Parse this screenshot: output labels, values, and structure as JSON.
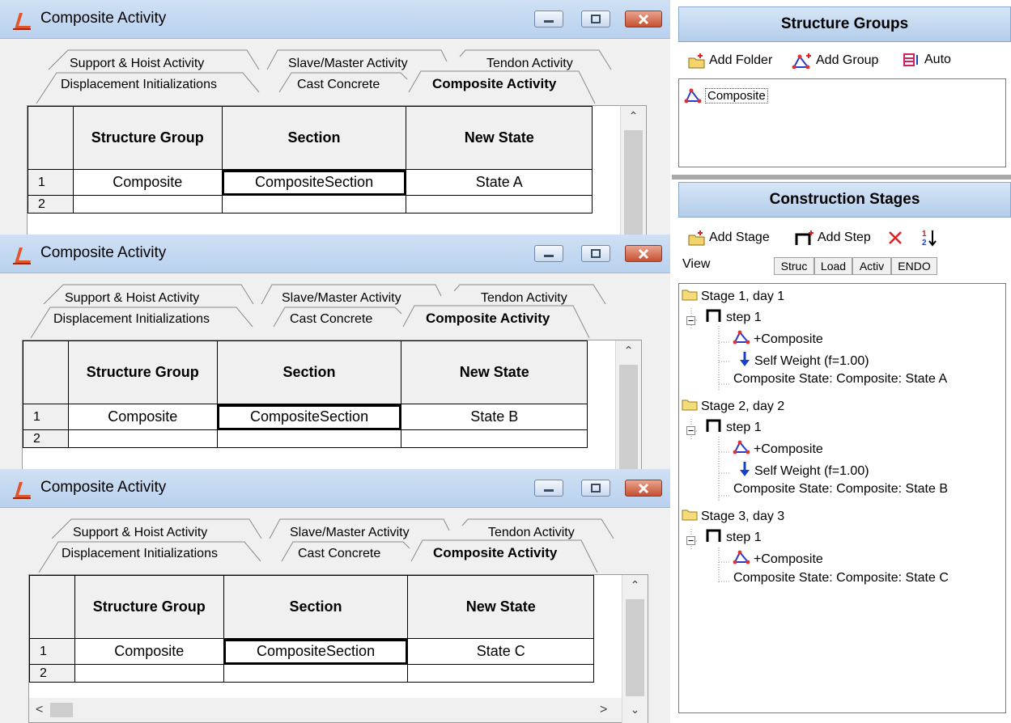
{
  "dialog": {
    "title": "Composite Activity",
    "tabs_back": [
      "Support & Hoist Activity",
      "Slave/Master Activity",
      "Tendon Activity"
    ],
    "tabs_front": [
      "Displacement Initializations",
      "Cast Concrete",
      "Composite Activity"
    ],
    "columns": [
      "Structure Group",
      "Section",
      "New State"
    ],
    "row_numbers": [
      "1",
      "2"
    ]
  },
  "dialogs": [
    {
      "row1": {
        "group": "Composite",
        "section": "CompositeSection",
        "state": "State A"
      }
    },
    {
      "row1": {
        "group": "Composite",
        "section": "CompositeSection",
        "state": "State B"
      }
    },
    {
      "row1": {
        "group": "Composite",
        "section": "CompositeSection",
        "state": "State C"
      }
    }
  ],
  "structure_groups": {
    "title": "Structure Groups",
    "toolbar": {
      "add_folder": "Add Folder",
      "add_group": "Add Group",
      "auto": "Auto"
    },
    "items": [
      "Composite"
    ]
  },
  "construction_stages": {
    "title": "Construction Stages",
    "toolbar": {
      "add_stage": "Add Stage",
      "add_step": "Add Step"
    },
    "view_label": "View",
    "view_buttons": [
      "Struc",
      "Load",
      "Activ",
      "ENDO"
    ],
    "tree": [
      {
        "stage": "Stage 1, day 1",
        "step": "step 1",
        "items": [
          "+Composite",
          "Self Weight (f=1.00)",
          "Composite State: Composite: State A"
        ]
      },
      {
        "stage": "Stage 2, day 2",
        "step": "step 1",
        "items": [
          "+Composite",
          "Self Weight (f=1.00)",
          "Composite State: Composite: State B"
        ]
      },
      {
        "stage": "Stage 3, day 3",
        "step": "step 1",
        "items": [
          "+Composite",
          "Composite State: Composite: State C"
        ]
      }
    ]
  },
  "colors": {
    "titlebar": "#b9d1ee",
    "close_button": "#c75032",
    "panel_header": "#b4cdea"
  }
}
